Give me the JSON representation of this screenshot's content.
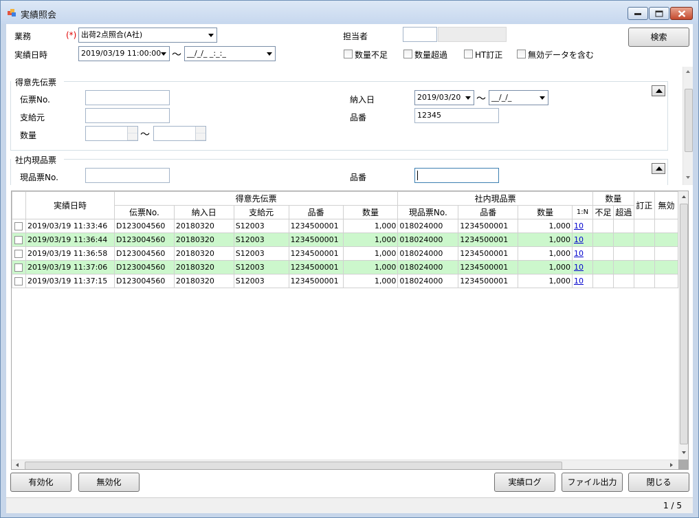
{
  "window": {
    "title": "実績照会"
  },
  "search": {
    "business_label": "業務",
    "required_mark": "(*)",
    "business_value": "出荷2点照合(A社)",
    "date_label": "実績日時",
    "date_from": "2019/03/19 11:00:00",
    "date_to": "__/_/_ _:_:_",
    "tilde": "〜",
    "staff_label": "担当者",
    "search_button": "検索",
    "checkboxes": [
      "数量不足",
      "数量超過",
      "HT訂正",
      "無効データを含む"
    ]
  },
  "customer_slip": {
    "title": "得意先伝票",
    "slip_no_label": "伝票No.",
    "supplier_label": "支給元",
    "quantity_label": "数量",
    "delivery_label": "納入日",
    "delivery_from": "2019/03/20",
    "delivery_to": "__/_/_",
    "part_label": "品番",
    "part_value": "12345"
  },
  "internal_slip": {
    "title": "社内現品票",
    "slip_no_label": "現品票No.",
    "part_label": "品番"
  },
  "grid": {
    "group_headers": {
      "datetime": "実績日時",
      "customer": "得意先伝票",
      "internal": "社内現品票",
      "quantity": "数量",
      "correction": "訂正",
      "invalid": "無効"
    },
    "sub_headers": {
      "c_slip": "伝票No.",
      "c_delivery": "納入日",
      "c_supplier": "支給元",
      "c_part": "品番",
      "c_qty": "数量",
      "i_slip": "現品票No.",
      "i_part": "品番",
      "i_qty": "数量",
      "ratio": "1:N",
      "short": "不足",
      "over": "超過"
    },
    "rows": [
      {
        "datetime": "2019/03/19 11:33:46",
        "slip": "D123004560",
        "delivery": "20180320",
        "supplier": "S12003",
        "part": "1234500001",
        "qty": "1,000",
        "i_slip": "018024000",
        "i_part": "1234500001",
        "i_qty": "1,000",
        "ratio": "10"
      },
      {
        "datetime": "2019/03/19 11:36:44",
        "slip": "D123004560",
        "delivery": "20180320",
        "supplier": "S12003",
        "part": "1234500001",
        "qty": "1,000",
        "i_slip": "018024000",
        "i_part": "1234500001",
        "i_qty": "1,000",
        "ratio": "10"
      },
      {
        "datetime": "2019/03/19 11:36:58",
        "slip": "D123004560",
        "delivery": "20180320",
        "supplier": "S12003",
        "part": "1234500001",
        "qty": "1,000",
        "i_slip": "018024000",
        "i_part": "1234500001",
        "i_qty": "1,000",
        "ratio": "10"
      },
      {
        "datetime": "2019/03/19 11:37:06",
        "slip": "D123004560",
        "delivery": "20180320",
        "supplier": "S12003",
        "part": "1234500001",
        "qty": "1,000",
        "i_slip": "018024000",
        "i_part": "1234500001",
        "i_qty": "1,000",
        "ratio": "10"
      },
      {
        "datetime": "2019/03/19 11:37:15",
        "slip": "D123004560",
        "delivery": "20180320",
        "supplier": "S12003",
        "part": "1234500001",
        "qty": "1,000",
        "i_slip": "018024000",
        "i_part": "1234500001",
        "i_qty": "1,000",
        "ratio": "10"
      }
    ]
  },
  "footer": {
    "enable_button": "有効化",
    "disable_button": "無効化",
    "log_button": "実績ログ",
    "export_button": "ファイル出力",
    "close_button": "閉じる",
    "pager": "1 / 5"
  },
  "colors": {
    "alt_row": "#ccf7cc",
    "required": "#e00000",
    "link": "#0000cc"
  }
}
